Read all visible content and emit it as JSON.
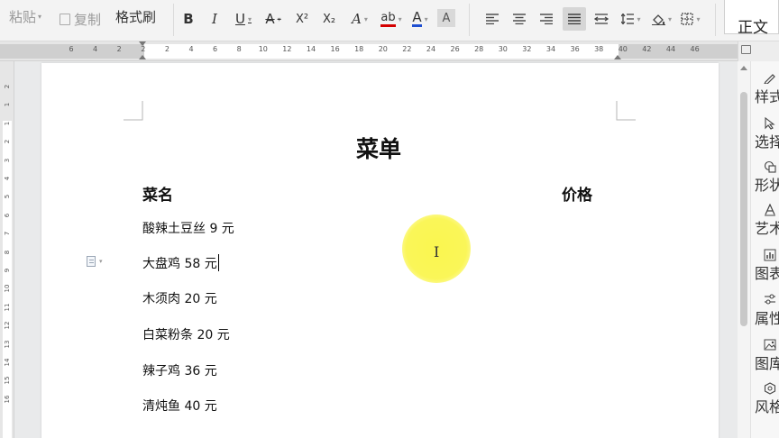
{
  "toolbar": {
    "paste_label": "粘贴",
    "copy_label": "复制",
    "format_painter_label": "格式刷",
    "bold_label": "B",
    "italic_label": "I",
    "underline_label": "U",
    "strikethrough_label": "A",
    "superscript_label": "X²",
    "subscript_label": "X₂",
    "text_effect_label": "A",
    "highlight_label": "ab",
    "font_color_label": "A",
    "char_shading_label": "A",
    "style_preview": "正文"
  },
  "ruler": {
    "horizontal_ticks": [
      "6",
      "4",
      "2",
      "2",
      "2",
      "4",
      "6",
      "8",
      "10",
      "12",
      "14",
      "16",
      "18",
      "20",
      "22",
      "24",
      "26",
      "28",
      "30",
      "32",
      "34",
      "36",
      "38",
      "40",
      "42",
      "44",
      "46"
    ],
    "vertical_ticks": [
      "2",
      "1",
      "1",
      "2",
      "3",
      "4",
      "5",
      "6",
      "7",
      "8",
      "9",
      "10",
      "11",
      "12",
      "13",
      "14",
      "15",
      "16"
    ]
  },
  "document": {
    "title": "菜单",
    "header_left": "菜名",
    "header_right": "价格",
    "items": [
      "酸辣土豆丝 9 元",
      "大盘鸡 58 元",
      "木须肉 20 元",
      "白菜粉条 20 元",
      "辣子鸡 36 元",
      "清炖鱼 40 元"
    ]
  },
  "side_pane": {
    "items": [
      {
        "label": "样式",
        "icon": "pen-icon"
      },
      {
        "label": "选择",
        "icon": "cursor-icon"
      },
      {
        "label": "形状",
        "icon": "shapes-icon"
      },
      {
        "label": "艺术字",
        "icon": "art-text-icon"
      },
      {
        "label": "图表",
        "icon": "chart-icon"
      },
      {
        "label": "属性",
        "icon": "sliders-icon"
      },
      {
        "label": "图库",
        "icon": "image-icon"
      },
      {
        "label": "风格",
        "icon": "hexagon-icon"
      }
    ]
  },
  "colors": {
    "highlight_yellow": "#faf546",
    "font_color_red": "#d40000",
    "font_color_blue": "#1f4fd1"
  }
}
